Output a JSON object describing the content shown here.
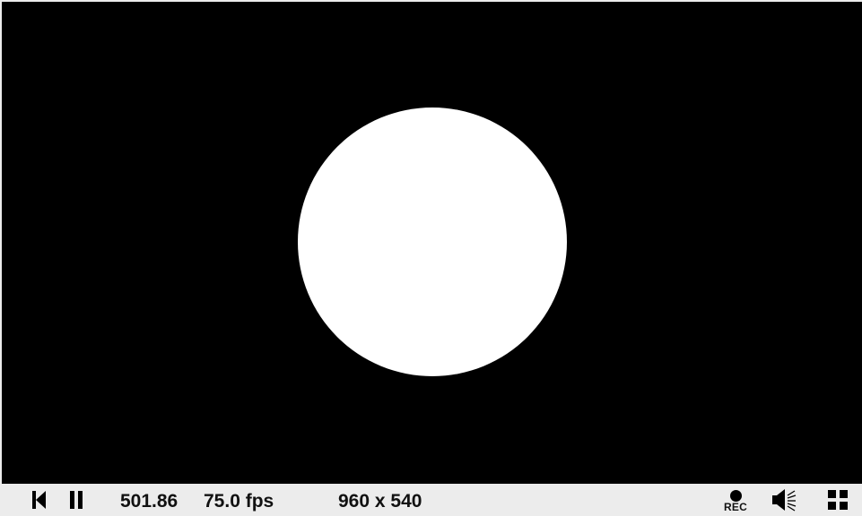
{
  "controls": {
    "time": "501.86",
    "fps": "75.0 fps",
    "resolution": "960 x 540",
    "rec_label": "REC"
  },
  "icons": {
    "rewind": "skip-to-start-icon",
    "pause": "pause-icon",
    "record": "record-icon",
    "volume": "volume-icon",
    "fullscreen": "fullscreen-icon"
  },
  "colors": {
    "canvas_bg": "#000000",
    "shape": "#ffffff",
    "bar_bg": "#ececec",
    "text": "#111111"
  }
}
